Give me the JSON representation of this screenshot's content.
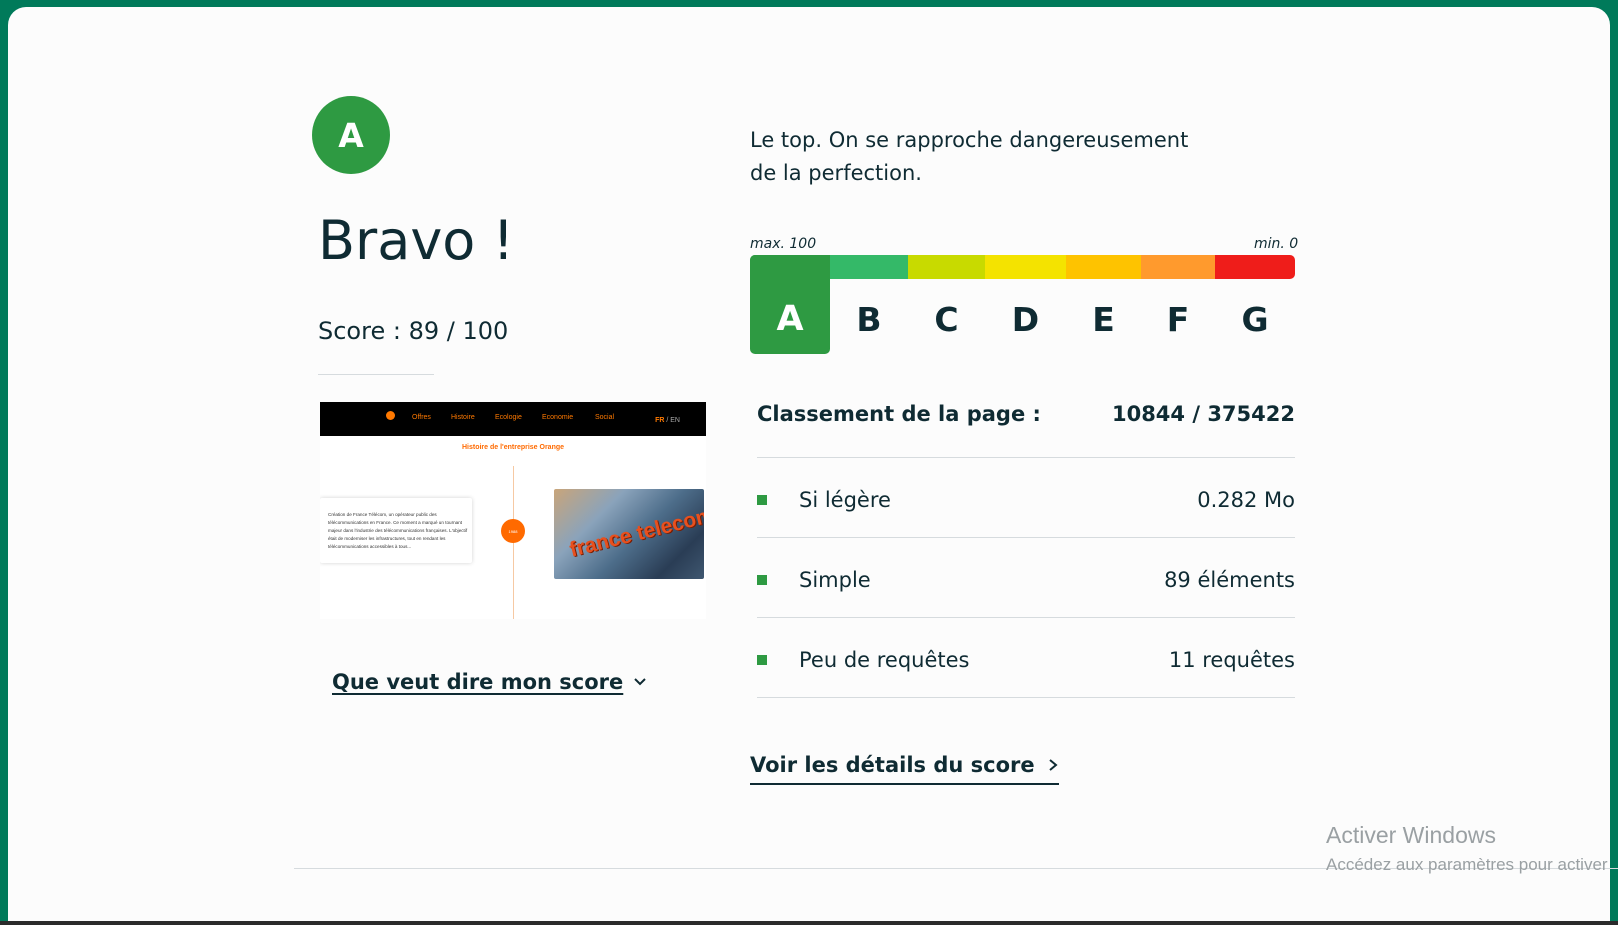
{
  "result": {
    "grade": "A",
    "title": "Bravo !",
    "score_text": "Score : 89 / 100",
    "score_value": 89,
    "score_max": 100
  },
  "preview": {
    "nav_links": [
      "Offres",
      "Histoire",
      "Ecologie",
      "Economie",
      "Social"
    ],
    "lang_active": "FR",
    "lang_sep": " / ",
    "lang_other": "EN",
    "heading": "Histoire de l'entreprise Orange",
    "card_text": "Création de France Télécom, un opérateur public des télécommunications en France. Ce moment a marqué un tournant majeur dans l'industrie des télécommunications françaises. L'objectif était de moderniser les infrastructures, tout en rendant les télécommunications accessibles à tous...",
    "year_marker": "1988",
    "photo_sign": "france telecom"
  },
  "links": {
    "score_meaning": "Que veut dire mon score",
    "details": "Voir les détails du score"
  },
  "description": "Le top. On se rapproche dangereusement de la perfection.",
  "scale": {
    "max_label": "max. 100",
    "min_label": "min. 0",
    "active": "A",
    "grades": [
      {
        "letter": "A",
        "color": "#2e9a42"
      },
      {
        "letter": "B",
        "color": "#34b968"
      },
      {
        "letter": "C",
        "color": "#c8da00"
      },
      {
        "letter": "D",
        "color": "#f4e300"
      },
      {
        "letter": "E",
        "color": "#fec300"
      },
      {
        "letter": "F",
        "color": "#ff9a2d"
      },
      {
        "letter": "G",
        "color": "#ef1d1a"
      }
    ]
  },
  "ranking": {
    "label": "Classement de la page :",
    "value": "10844 / 375422"
  },
  "metrics": [
    {
      "label": "Si légère",
      "value": "0.282 Mo"
    },
    {
      "label": "Simple",
      "value": "89 éléments"
    },
    {
      "label": "Peu de requêtes",
      "value": "11 requêtes"
    }
  ],
  "watermark": {
    "line1": "Activer Windows",
    "line2": "Accédez aux paramètres pour activer"
  },
  "colors": {
    "accent": "#2e9a42",
    "frame": "#007a5a",
    "text": "#0f2b33"
  }
}
